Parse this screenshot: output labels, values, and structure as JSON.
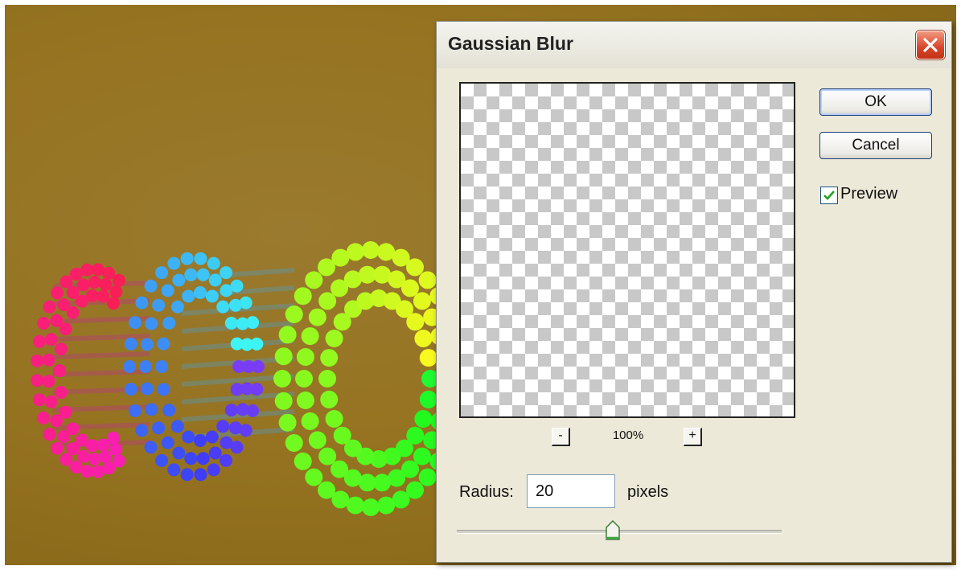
{
  "dialog": {
    "title": "Gaussian Blur",
    "ok_label": "OK",
    "cancel_label": "Cancel",
    "preview_label": "Preview",
    "preview_checked": true,
    "zoom": {
      "level": "100%",
      "zoom_out_label": "-",
      "zoom_in_label": "+"
    },
    "radius": {
      "label": "Radius:",
      "value": "20",
      "units": "pixels",
      "slider_fraction": 0.48
    },
    "close_icon": "close-icon"
  },
  "colors": {
    "background": "#957321",
    "dialog_bg": "#ece9d8",
    "close_button": "#d8452a"
  }
}
